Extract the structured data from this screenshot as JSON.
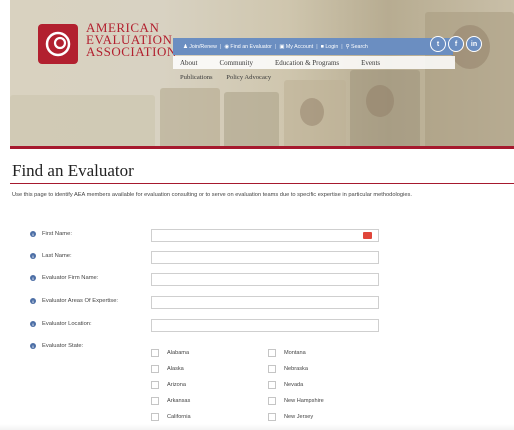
{
  "header": {
    "logo_lines": [
      "AMERICAN",
      "EVALUATION",
      "ASSOCIATION"
    ],
    "utility_links": [
      "Join/Renew",
      "Find an Evaluator",
      "My Account",
      "Login",
      "Search"
    ],
    "social_icons": [
      "twitter-icon",
      "facebook-icon",
      "linkedin-icon"
    ],
    "main_nav": [
      "About",
      "Community",
      "Education & Programs",
      "Events"
    ],
    "sub_nav": [
      "Publications",
      "Policy Advocacy"
    ],
    "colors": {
      "brand_red": "#b2202f",
      "utility_blue": "#6b8ec1"
    }
  },
  "page": {
    "title": "Find an Evaluator",
    "intro": "Use this page to identify AEA members available for evaluation consulting or to serve on evaluation teams due to specific expertise in particular methodologies."
  },
  "form": {
    "fields": [
      {
        "label": "First Name:",
        "value": ""
      },
      {
        "label": "Last Name:",
        "value": ""
      },
      {
        "label": "Evaluator Firm Name:",
        "value": ""
      },
      {
        "label": "Evaluator Areas Of Expertise:",
        "value": ""
      },
      {
        "label": "Evaluator Location:",
        "value": ""
      }
    ],
    "state_label": "Evaluator State:",
    "states_left": [
      "Alabama",
      "Alaska",
      "Arizona",
      "Arkansas",
      "California"
    ],
    "states_right": [
      "Montana",
      "Nebraska",
      "Nevada",
      "New Hampshire",
      "New Jersey"
    ]
  }
}
